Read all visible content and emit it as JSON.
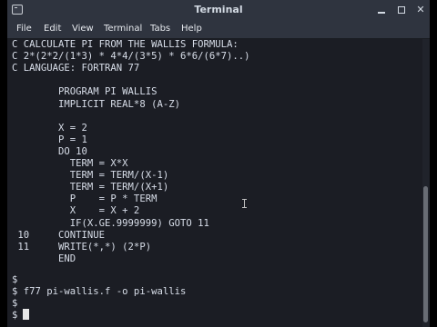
{
  "window": {
    "title": "Terminal"
  },
  "menubar": {
    "items": [
      {
        "label": "File"
      },
      {
        "label": "Edit"
      },
      {
        "label": "View"
      },
      {
        "label": "Terminal"
      },
      {
        "label": "Tabs"
      },
      {
        "label": "Help"
      }
    ]
  },
  "terminal": {
    "lines": [
      "C CALCULATE PI FROM THE WALLIS FORMULA:",
      "C 2*(2*2/(1*3) * 4*4/(3*5) * 6*6/(6*7)..)",
      "C LANGUAGE: FORTRAN 77",
      "",
      "        PROGRAM PI WALLIS",
      "        IMPLICIT REAL*8 (A-Z)",
      "",
      "        X = 2",
      "        P = 1",
      "        DO 10",
      "          TERM = X*X",
      "          TERM = TERM/(X-1)",
      "          TERM = TERM/(X+1)",
      "          P    = P * TERM",
      "          X    = X + 2",
      "          IF(X.GE.9999999) GOTO 11",
      " 10     CONTINUE",
      " 11     WRITE(*,*) (2*P)",
      "        END",
      "",
      "",
      "$",
      "$ f77 pi-wallis.f -o pi-wallis",
      "$",
      "$ "
    ]
  },
  "colors": {
    "titlebar_bg": "#2f343f",
    "terminal_bg": "#1b1d24",
    "terminal_fg": "#d8dee9"
  },
  "icons": {
    "title": "terminal-app-icon",
    "minimize": "minimize-icon",
    "maximize": "maximize-icon",
    "close": "close-icon"
  }
}
